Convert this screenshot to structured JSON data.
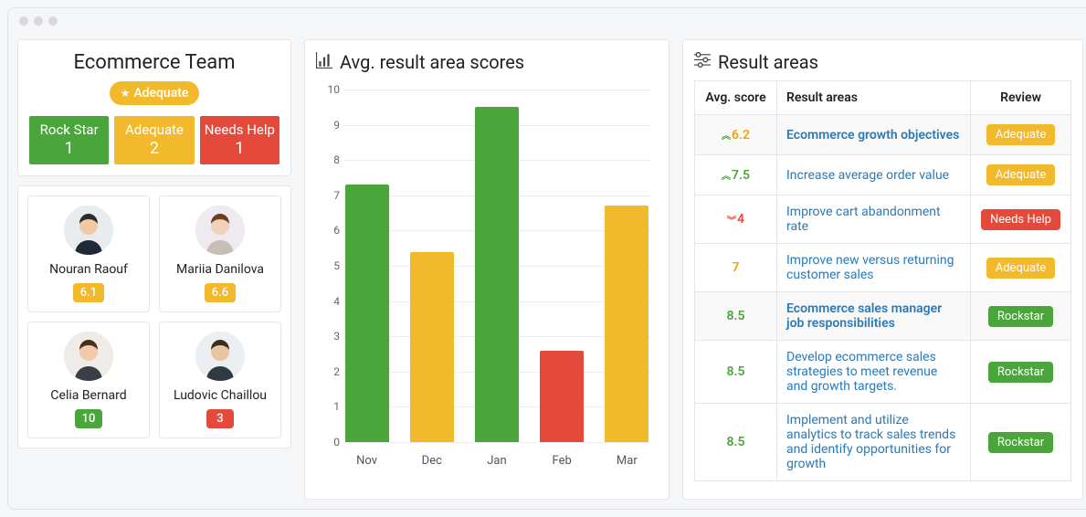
{
  "team": {
    "title": "Ecommerce Team",
    "status_label": "Adequate",
    "stats": {
      "rockstar_label": "Rock Star",
      "rockstar_count": "1",
      "adequate_label": "Adequate",
      "adequate_count": "2",
      "needs_help_label": "Needs Help",
      "needs_help_count": "1"
    }
  },
  "people": [
    {
      "name": "Nouran Raouf",
      "score": "6.1",
      "badge_class": "b-amber"
    },
    {
      "name": "Mariia Danilova",
      "score": "6.6",
      "badge_class": "b-amber"
    },
    {
      "name": "Celia Bernard",
      "score": "10",
      "badge_class": "b-green"
    },
    {
      "name": "Ludovic Chaillou",
      "score": "3",
      "badge_class": "b-red"
    }
  ],
  "chart_title": "Avg. result area scores",
  "chart_data": {
    "type": "bar",
    "title": "Avg. result area scores",
    "xlabel": "",
    "ylabel": "",
    "ylim": [
      0,
      10
    ],
    "categories": [
      "Nov",
      "Dec",
      "Jan",
      "Feb",
      "Mar"
    ],
    "values": [
      7.3,
      5.4,
      9.5,
      2.6,
      6.7
    ],
    "colors": [
      "#4aa63b",
      "#f3b92d",
      "#4aa63b",
      "#e44a3c",
      "#f3b92d"
    ],
    "yticks": [
      0,
      1,
      2,
      3,
      4,
      5,
      6,
      7,
      8,
      9,
      10
    ]
  },
  "result_title": "Result areas",
  "result_table": {
    "headers": {
      "avg": "Avg. score",
      "area": "Result areas",
      "review": "Review"
    },
    "rows": [
      {
        "group": true,
        "score": "6.2",
        "score_color": "amber-t",
        "trend": "up",
        "area": "Ecommerce growth objectives",
        "review_label": "Adequate",
        "review_class": "b-amber"
      },
      {
        "group": false,
        "score": "7.5",
        "score_color": "green-t",
        "trend": "up",
        "area": "Increase average order value",
        "review_label": "Adequate",
        "review_class": "b-amber"
      },
      {
        "group": false,
        "score": "4",
        "score_color": "red-t",
        "trend": "down",
        "area": "Improve cart abandonment rate",
        "review_label": "Needs Help",
        "review_class": "b-red"
      },
      {
        "group": false,
        "score": "7",
        "score_color": "amber-t",
        "trend": "",
        "area": "Improve new versus returning customer sales",
        "review_label": "Adequate",
        "review_class": "b-amber"
      },
      {
        "group": true,
        "score": "8.5",
        "score_color": "green-t",
        "trend": "",
        "area": "Ecommerce sales manager job responsibilities",
        "review_label": "Rockstar",
        "review_class": "b-green"
      },
      {
        "group": false,
        "score": "8.5",
        "score_color": "green-t",
        "trend": "",
        "area": "Develop ecommerce sales strategies to meet revenue and growth targets.",
        "review_label": "Rockstar",
        "review_class": "b-green"
      },
      {
        "group": false,
        "score": "8.5",
        "score_color": "green-t",
        "trend": "",
        "area": "Implement and utilize analytics to track sales trends and identify opportunities for growth",
        "review_label": "Rockstar",
        "review_class": "b-green"
      }
    ]
  }
}
